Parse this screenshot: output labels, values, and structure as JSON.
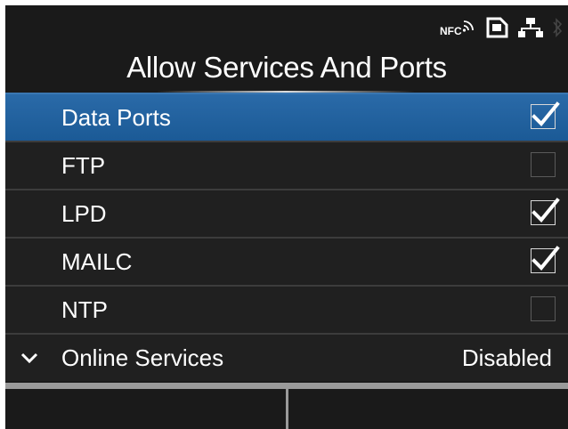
{
  "status": {
    "nfc_label": "NFC",
    "icons": [
      "nfc-icon",
      "storage-icon",
      "network-icon",
      "bluetooth-icon"
    ]
  },
  "title": "Allow Services And Ports",
  "items": [
    {
      "label": "Data Ports",
      "checked": true,
      "selected": true
    },
    {
      "label": "FTP",
      "checked": false,
      "selected": false
    },
    {
      "label": "LPD",
      "checked": true,
      "selected": false
    },
    {
      "label": "MAILC",
      "checked": true,
      "selected": false
    },
    {
      "label": "NTP",
      "checked": false,
      "selected": false
    }
  ],
  "online_services": {
    "label": "Online Services",
    "value": "Disabled"
  },
  "softkeys": [
    {
      "label": ""
    },
    {
      "label": ""
    }
  ],
  "colors": {
    "background": "#1a1a1a",
    "selected_row": "#1f5f9d",
    "text": "#ffffff"
  }
}
